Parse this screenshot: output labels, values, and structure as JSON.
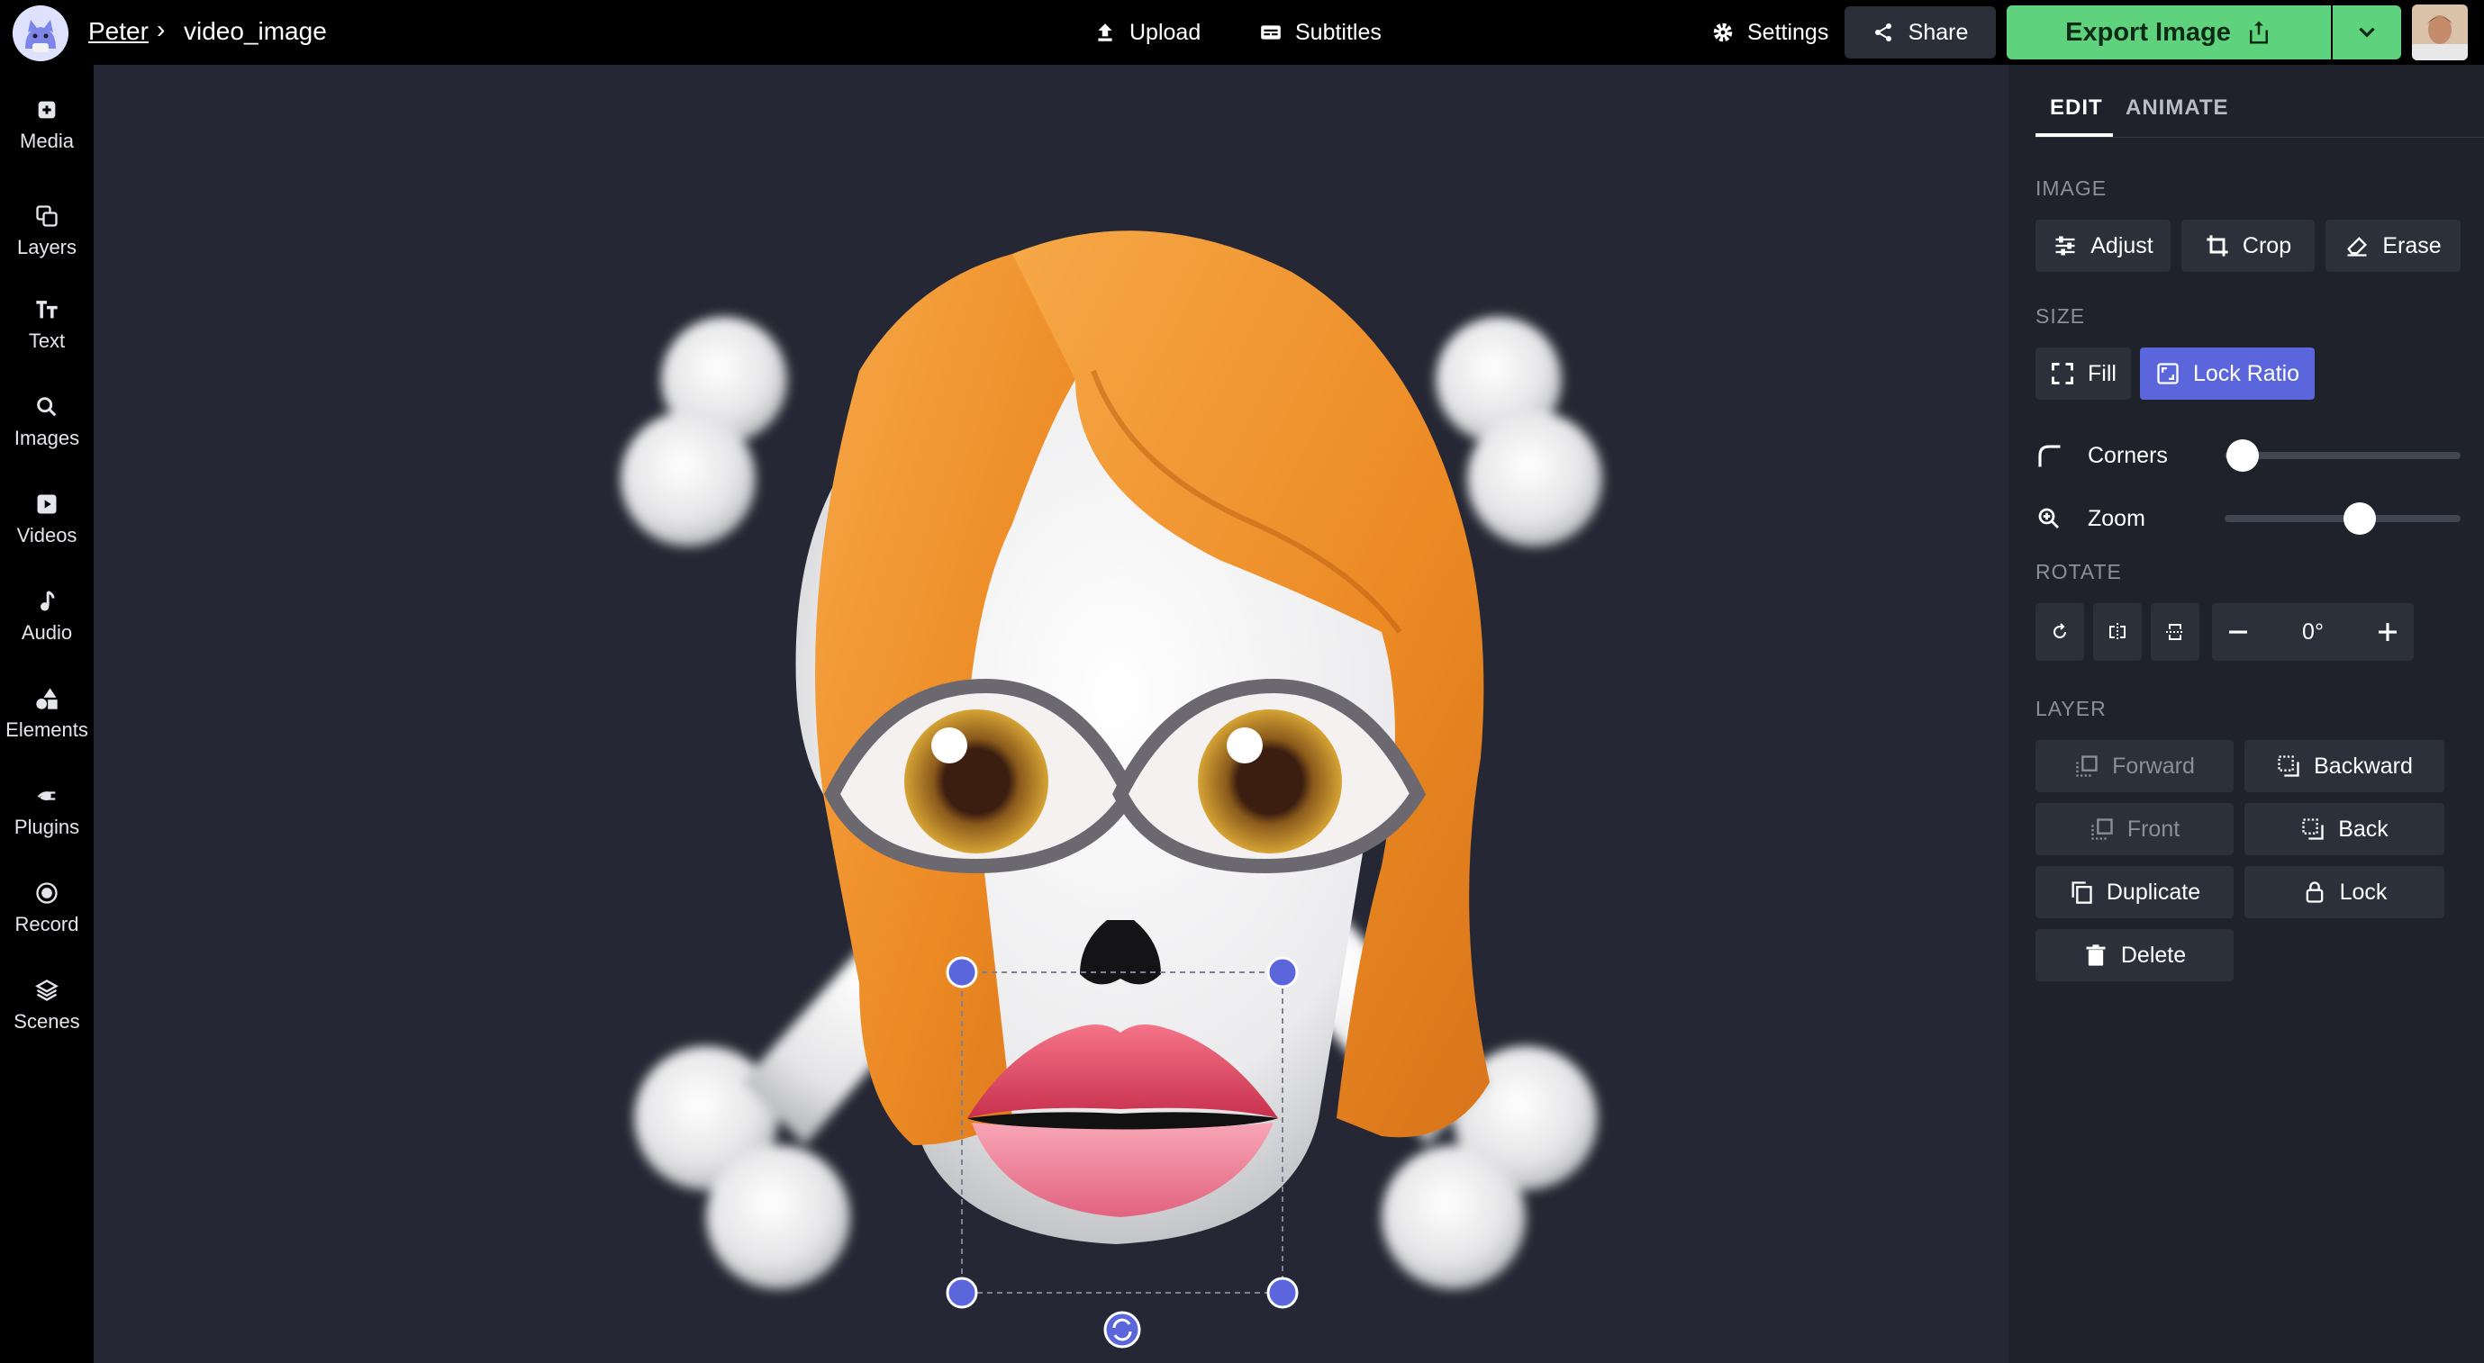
{
  "header": {
    "breadcrumb_user": "Peter",
    "breadcrumb_separator": "›",
    "project_title": "video_image",
    "upload_label": "Upload",
    "subtitles_label": "Subtitles",
    "settings_label": "Settings",
    "share_label": "Share",
    "export_label": "Export Image"
  },
  "sidebar": {
    "items": [
      {
        "label": "Media",
        "icon": "media-icon"
      },
      {
        "label": "Layers",
        "icon": "layers-icon"
      },
      {
        "label": "Text",
        "icon": "text-icon"
      },
      {
        "label": "Images",
        "icon": "search-icon"
      },
      {
        "label": "Videos",
        "icon": "video-icon"
      },
      {
        "label": "Audio",
        "icon": "music-note-icon"
      },
      {
        "label": "Elements",
        "icon": "shapes-icon"
      },
      {
        "label": "Plugins",
        "icon": "plug-icon"
      },
      {
        "label": "Record",
        "icon": "record-icon"
      },
      {
        "label": "Scenes",
        "icon": "stack-icon"
      }
    ]
  },
  "panel": {
    "tabs": [
      "EDIT",
      "ANIMATE"
    ],
    "active_tab": "EDIT",
    "image_section": "IMAGE",
    "adjust_label": "Adjust",
    "crop_label": "Crop",
    "erase_label": "Erase",
    "size_section": "SIZE",
    "fill_label": "Fill",
    "lock_ratio_label": "Lock Ratio",
    "corners_label": "Corners",
    "corners_value": 0,
    "zoom_label": "Zoom",
    "zoom_value": 0.5,
    "rotate_section": "ROTATE",
    "rotate_value": "0°",
    "layer_section": "LAYER",
    "forward_label": "Forward",
    "backward_label": "Backward",
    "front_label": "Front",
    "back_label": "Back",
    "duplicate_label": "Duplicate",
    "lock_label": "Lock",
    "delete_label": "Delete"
  },
  "colors": {
    "accent": "#5b65dc",
    "export_green": "#5fd27e",
    "canvas_bg": "#252834",
    "panel_bg": "#1f222b"
  }
}
